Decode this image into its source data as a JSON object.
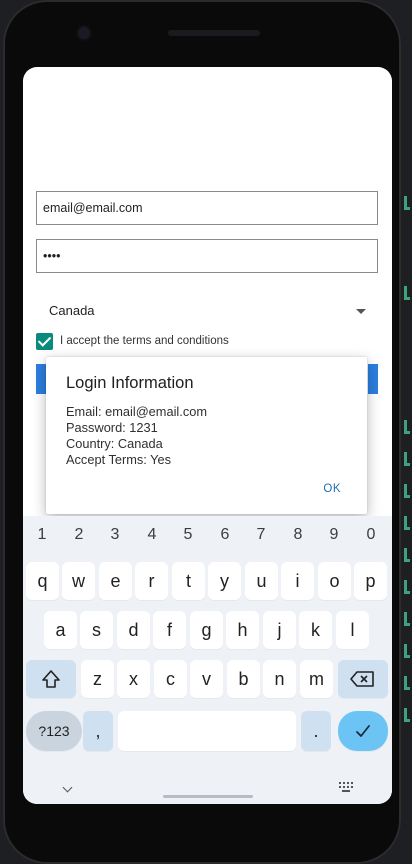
{
  "form": {
    "email_value": "email@email.com",
    "password_value": "••••",
    "country": "Canada",
    "accept_label": "I accept the terms and conditions"
  },
  "dialog": {
    "title": "Login Information",
    "email_line": "Email: email@email.com",
    "password_line": "Password: 1231",
    "country_line": "Country: Canada",
    "terms_line": "Accept Terms: Yes",
    "ok_label": "OK"
  },
  "keyboard": {
    "numbers": [
      "1",
      "2",
      "3",
      "4",
      "5",
      "6",
      "7",
      "8",
      "9",
      "0"
    ],
    "row1": [
      "q",
      "w",
      "e",
      "r",
      "t",
      "y",
      "u",
      "i",
      "o",
      "p"
    ],
    "row2": [
      "a",
      "s",
      "d",
      "f",
      "g",
      "h",
      "j",
      "k",
      "l"
    ],
    "row3": [
      "z",
      "x",
      "c",
      "v",
      "b",
      "n",
      "m"
    ],
    "symbols_label": "?123",
    "comma_label": ",",
    "period_label": "."
  },
  "icons": {
    "shift": "shift-icon",
    "backspace": "backspace-icon",
    "enter": "checkmark-icon",
    "hide_keyboard": "chevron-down-icon",
    "switch_keyboard": "keyboard-grid-icon"
  },
  "colors": {
    "checkbox": "#0a8a7d",
    "button_blue": "#2b7fe0",
    "dialog_action": "#1f6fb4",
    "enter_key": "#6cc4f5"
  }
}
